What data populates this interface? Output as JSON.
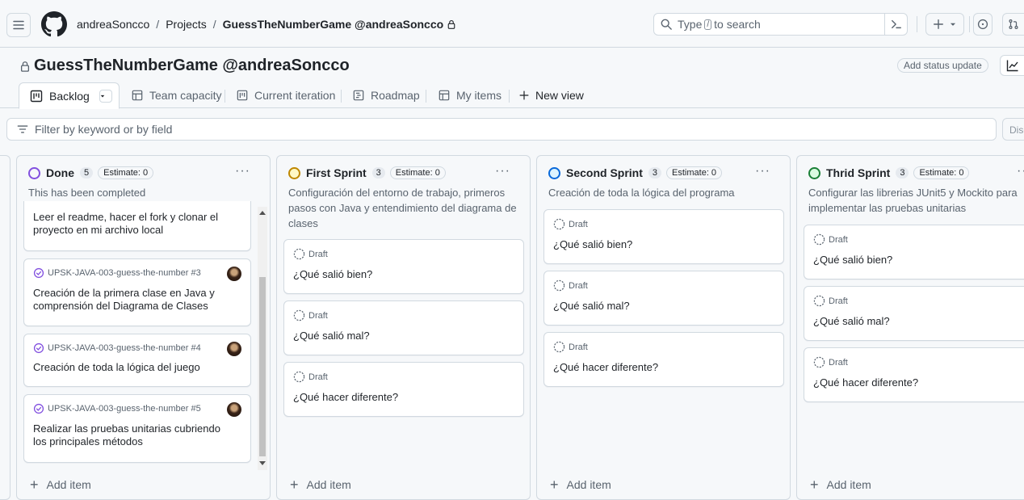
{
  "breadcrumb": {
    "owner": "andreaSoncco",
    "projects": "Projects",
    "project": "GuessTheNumberGame @andreaSoncco"
  },
  "search": {
    "pre": "Type",
    "key": "/",
    "post": "to search"
  },
  "project_title": "GuessTheNumberGame @andreaSoncco",
  "status_update_label": "Add status update",
  "tabs": [
    {
      "label": "Backlog",
      "icon": "board-icon",
      "active": true
    },
    {
      "label": "Team capacity",
      "icon": "table-icon"
    },
    {
      "label": "Current iteration",
      "icon": "board-icon"
    },
    {
      "label": "Roadmap",
      "icon": "roadmap-icon"
    },
    {
      "label": "My items",
      "icon": "table-icon"
    },
    {
      "label": "New view",
      "icon": "plus-icon"
    }
  ],
  "filter_placeholder": "Filter by keyword or by field",
  "discard_label": "Disc",
  "columns": [
    {
      "name": "Done",
      "count": "5",
      "estimate": "Estimate: 0",
      "color": "#8250df",
      "description": "This has been completed",
      "cards": [
        {
          "title": "Leer el readme, hacer el fork y clonar el proyecto en mi archivo local"
        },
        {
          "issue": "UPSK-JAVA-003-guess-the-number #3",
          "title": "Creación de la primera clase en Java y comprensión del Diagrama de Clases"
        },
        {
          "issue": "UPSK-JAVA-003-guess-the-number #4",
          "title": "Creación de toda la lógica del juego"
        },
        {
          "issue": "UPSK-JAVA-003-guess-the-number #5",
          "title": "Realizar las pruebas unitarias cubriendo los principales métodos"
        }
      ]
    },
    {
      "name": "First Sprint",
      "count": "3",
      "estimate": "Estimate: 0",
      "color": "#bf8700",
      "description": "Configuración del entorno de trabajo, primeros pasos con Java y entendimiento del diagrama de clases",
      "cards": [
        {
          "draft": "Draft",
          "title": "¿Qué salió bien?"
        },
        {
          "draft": "Draft",
          "title": "¿Qué salió mal?"
        },
        {
          "draft": "Draft",
          "title": "¿Qué hacer diferente?"
        }
      ]
    },
    {
      "name": "Second Sprint",
      "count": "3",
      "estimate": "Estimate: 0",
      "color": "#0969da",
      "description": "Creación de toda la lógica del programa",
      "cards": [
        {
          "draft": "Draft",
          "title": "¿Qué salió bien?"
        },
        {
          "draft": "Draft",
          "title": "¿Qué salió mal?"
        },
        {
          "draft": "Draft",
          "title": "¿Qué hacer diferente?"
        }
      ]
    },
    {
      "name": "Thrid Sprint",
      "count": "3",
      "estimate": "Estimate: 0",
      "color": "#1a7f37",
      "description": "Configurar las librerias JUnit5 y Mockito para implementar las pruebas unitarias",
      "cards": [
        {
          "draft": "Draft",
          "title": "¿Qué salió bien?"
        },
        {
          "draft": "Draft",
          "title": "¿Qué salió mal?"
        },
        {
          "draft": "Draft",
          "title": "¿Qué hacer diferente?"
        }
      ]
    }
  ],
  "add_item_label": "Add item"
}
